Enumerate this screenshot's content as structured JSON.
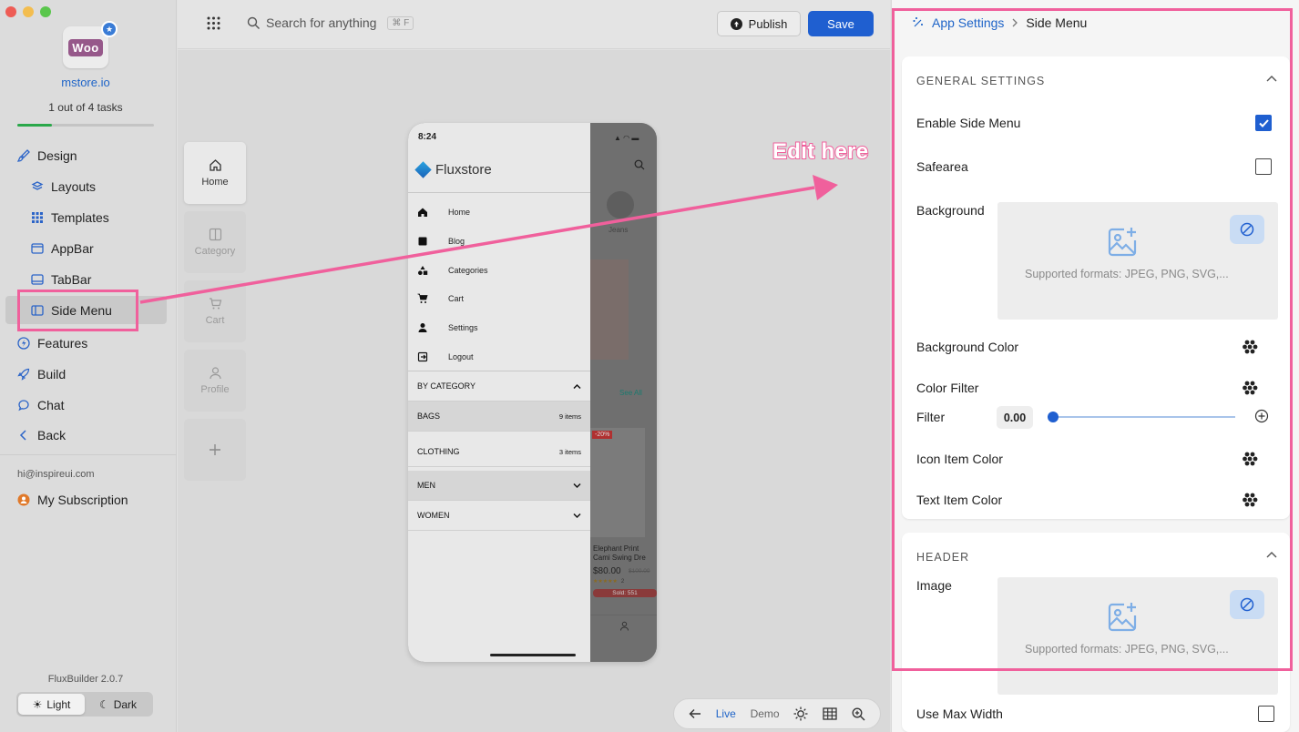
{
  "sidebar": {
    "site": "mstore.io",
    "tasks": "1 out of 4 tasks",
    "task_progress": 0.25,
    "logo_text": "Woo",
    "nav": {
      "design": "Design",
      "layouts": "Layouts",
      "templates": "Templates",
      "appbar": "AppBar",
      "tabbar": "TabBar",
      "sidemenu": "Side Menu",
      "features": "Features",
      "build": "Build",
      "chat": "Chat",
      "back": "Back"
    },
    "email": "hi@inspireui.com",
    "subscription": "My Subscription",
    "version": "FluxBuilder 2.0.7",
    "theme": {
      "light": "Light",
      "dark": "Dark",
      "selected": "Light"
    }
  },
  "topbar": {
    "search_placeholder": "Search for anything",
    "search_shortcut": "⌘ F",
    "publish": "Publish",
    "save": "Save"
  },
  "tabs": {
    "home": "Home",
    "category": "Category",
    "cart": "Cart",
    "profile": "Profile"
  },
  "phone": {
    "time": "8:24",
    "brand": "Fluxstore",
    "menu": [
      "Home",
      "Blog",
      "Categories",
      "Cart",
      "Settings",
      "Logout"
    ],
    "by_category": "BY CATEGORY",
    "categories": [
      {
        "name": "BAGS",
        "count": "9 items"
      },
      {
        "name": "CLOTHING",
        "count": "3 items"
      },
      {
        "name": "MEN",
        "count": ""
      },
      {
        "name": "WOMEN",
        "count": ""
      }
    ],
    "peek": {
      "jeans": "Jeans",
      "see_all": "See All",
      "discount": "-20%",
      "product_name": "Elephant Print Cami Swing Dre",
      "price": "$80.00",
      "old_price": "$100.00",
      "rating_count": "2",
      "sold": "Sold: 551"
    }
  },
  "bottom_toolbar": {
    "live": "Live",
    "demo": "Demo"
  },
  "annotation": {
    "text": "Edit here",
    "color": "#f0609c"
  },
  "panel": {
    "breadcrumb": {
      "parent": "App Settings",
      "current": "Side Menu"
    },
    "general": {
      "title": "GENERAL SETTINGS",
      "enable_side_menu": {
        "label": "Enable Side Menu",
        "checked": true
      },
      "safearea": {
        "label": "Safearea",
        "checked": false
      },
      "background": {
        "label": "Background",
        "hint": "Supported formats: JPEG, PNG, SVG,..."
      },
      "background_color": "Background Color",
      "color_filter": "Color Filter",
      "filter": {
        "label": "Filter",
        "value": "0.00"
      },
      "icon_item_color": "Icon Item Color",
      "text_item_color": "Text Item Color"
    },
    "header": {
      "title": "HEADER",
      "image": {
        "label": "Image",
        "hint": "Supported formats: JPEG, PNG, SVG,..."
      },
      "use_max_width": {
        "label": "Use Max Width",
        "checked": false
      }
    }
  },
  "colors": {
    "accent": "#1f5fd0",
    "highlight": "#f0609c",
    "progress": "#2aa84a"
  }
}
